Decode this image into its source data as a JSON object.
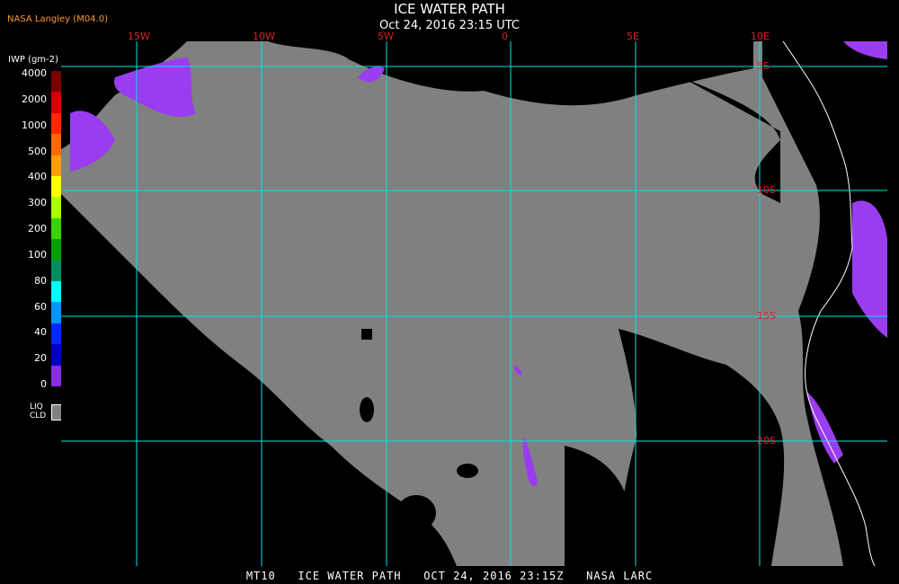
{
  "header": {
    "producer": "NASA Langley (M04.0)",
    "title": "ICE WATER PATH",
    "timestamp": "Oct 24, 2016 23:15 UTC"
  },
  "legend": {
    "title": "IWP (gm-2)",
    "ticks": [
      "4000",
      "2000",
      "1000",
      "500",
      "400",
      "300",
      "200",
      "100",
      "80",
      "60",
      "40",
      "20",
      "0"
    ],
    "colors": [
      "#7a0000",
      "#d40000",
      "#ff2800",
      "#ff6a00",
      "#ffa000",
      "#ffff00",
      "#a8ff00",
      "#3cd200",
      "#00a000",
      "#008a60",
      "#00ffff",
      "#0096ff",
      "#0028ff",
      "#0000c0",
      "#8a2be2"
    ],
    "liq_label_line1": "LIQ",
    "liq_label_line2": "CLD",
    "liq_color": "#808080"
  },
  "map": {
    "lon_labels": [
      "15W",
      "10W",
      "5W",
      "0",
      "5E",
      "10E"
    ],
    "lat_labels": [
      "5S",
      "10S",
      "15S",
      "20S"
    ],
    "grid_color": "#00e5e5",
    "cloud_color": "#808080",
    "ice_color": "#9a3cf0",
    "coast_color": "#ffffff"
  },
  "footer": {
    "text": "MT10   ICE WATER PATH   OCT 24, 2016 23:15Z   NASA LARC"
  }
}
